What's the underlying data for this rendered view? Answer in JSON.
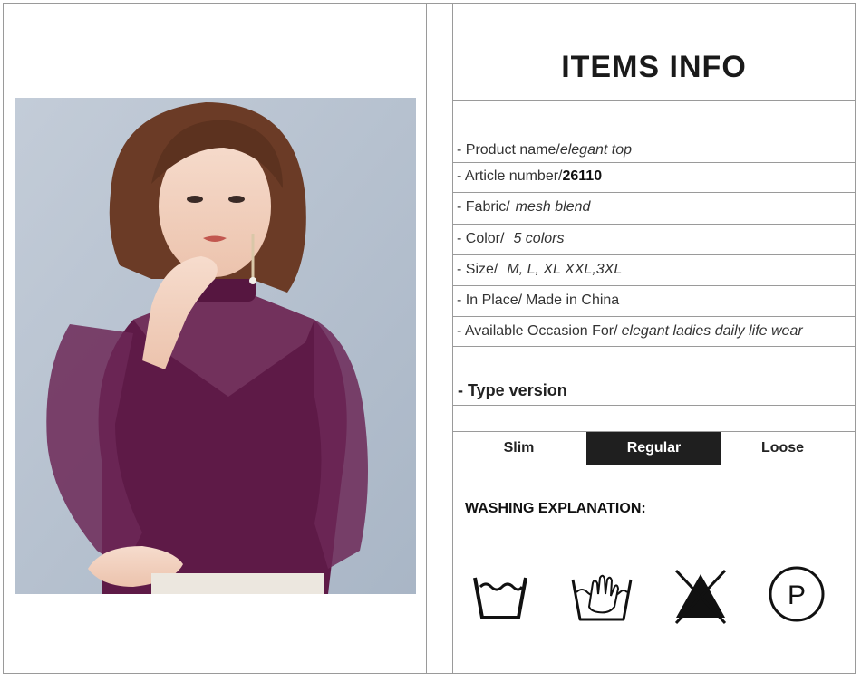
{
  "title": "ITEMS INFO",
  "info_rows": [
    {
      "label": "- Product name/",
      "value": "elegant top",
      "bold": false
    },
    {
      "label": "- Article number/",
      "value": "26110",
      "bold": true
    },
    {
      "label": "- Fabric/",
      "value": "mesh blend",
      "bold": false
    },
    {
      "label": "- Color/",
      "value": "5 colors",
      "bold": false
    },
    {
      "label": "- Size/",
      "value": "M, L, XL XXL,3XL",
      "bold": false
    },
    {
      "label": "- In Place/",
      "value": "Made in China",
      "bold": false
    },
    {
      "label": "- Available Occasion For/",
      "value": "elegant ladies daily life wear",
      "bold": false
    }
  ],
  "type_version": "- Type version",
  "fit_options": [
    {
      "label": "Slim",
      "selected": false
    },
    {
      "label": "Regular",
      "selected": true
    },
    {
      "label": "Loose",
      "selected": false
    }
  ],
  "washing_title": "WASHING EXPLANATION:",
  "care_icons": [
    "wash-tub-icon",
    "hand-wash-icon",
    "no-bleach-icon",
    "dry-clean-p-icon"
  ],
  "care_letter": "P",
  "colors": {
    "garment": "#5e1a47",
    "selected_fit": "#1f1f1f",
    "border": "#9a9a9a"
  }
}
